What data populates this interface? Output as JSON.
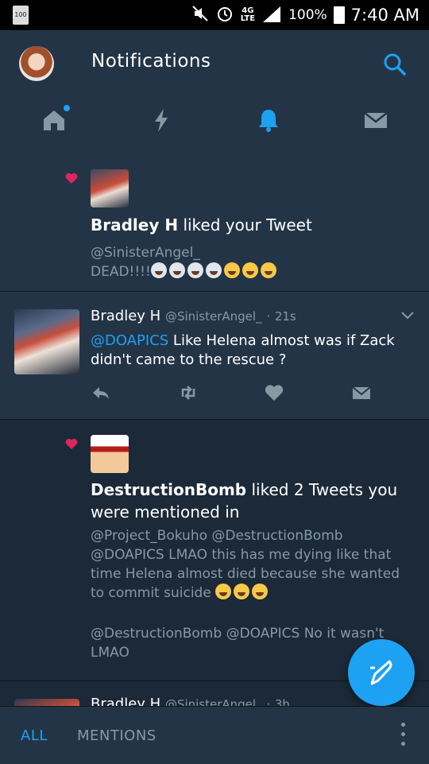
{
  "status_bar": {
    "badge": "100",
    "network": [
      "4G",
      "LTE"
    ],
    "battery_percent": "100%",
    "time": "7:40 AM"
  },
  "header": {
    "title": "Notifications",
    "tabs": [
      {
        "name": "home",
        "icon": "home-icon",
        "active": false,
        "has_dot": true
      },
      {
        "name": "moments",
        "icon": "lightning-icon",
        "active": false
      },
      {
        "name": "notifications",
        "icon": "bell-icon",
        "active": true
      },
      {
        "name": "messages",
        "icon": "envelope-icon",
        "active": false
      }
    ]
  },
  "feed": {
    "notification1": {
      "user": "Bradley H",
      "action": "liked your Tweet",
      "handle": "@SinisterAngel_",
      "text": "DEAD!!!!"
    },
    "tweet": {
      "name": "Bradley H",
      "handle": "@SinisterAngel_",
      "time": "21s",
      "mention": "@DOAPICS",
      "text": " Like Helena almost was if Zack didn't came to the rescue ?"
    },
    "notification2": {
      "user": "DestructionBomb",
      "action": "liked 2 Tweets you were mentioned in",
      "text1": "@Project_Bokuho @DestructionBomb @DOAPICS LMAO this has me dying like that time Helena almost died because she wanted to commit suicide",
      "text2": "@DestructionBomb @DOAPICS No it wasn't LMAO"
    },
    "peek": {
      "name": "Bradley H",
      "handle": "@SinisterAngel_",
      "time": "3h"
    }
  },
  "bottom_bar": {
    "all_label": "ALL",
    "mentions_label": "MENTIONS"
  },
  "colors": {
    "accent": "#1da1f2",
    "background": "#1c2938",
    "card": "#243447",
    "secondary_text": "#8899a6",
    "heart": "#e0245e"
  }
}
